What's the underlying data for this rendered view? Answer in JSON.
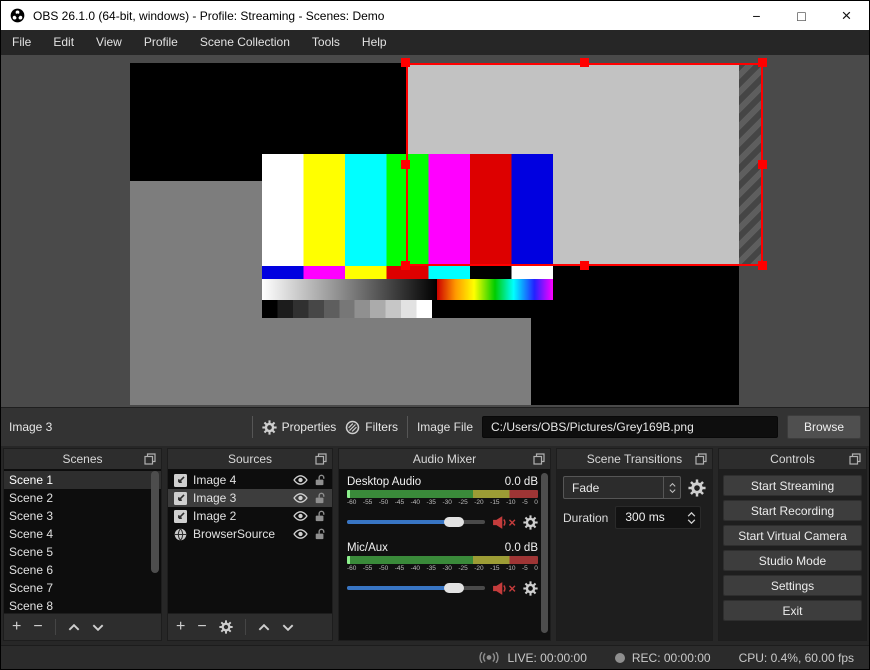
{
  "window": {
    "title": "OBS 26.1.0 (64-bit, windows) - Profile: Streaming - Scenes: Demo",
    "controls": {
      "minimize": "−",
      "maximize": "□",
      "close": "×"
    }
  },
  "menu": {
    "items": [
      "File",
      "Edit",
      "View",
      "Profile",
      "Scene Collection",
      "Tools",
      "Help"
    ]
  },
  "preview": {
    "selection_color": "#ff0000",
    "background": "#4a4a4a",
    "regions": {
      "black": "#000000",
      "grey": "#7d7d7d",
      "light_grey": "#c2c2c2"
    },
    "color_bars": [
      "#ffffff",
      "#ffff00",
      "#00ffff",
      "#00ff00",
      "#ff00ff",
      "#dd0000",
      "#0000e0"
    ],
    "strip_colors": [
      "#0000e0",
      "#ff00ff",
      "#ffff00",
      "#dd0000",
      "#00ffff",
      "#000000",
      "#ffffff"
    ]
  },
  "source_toolbar": {
    "source_name": "Image 3",
    "properties_label": "Properties",
    "filters_label": "Filters",
    "image_file_label": "Image File",
    "image_file_value": "C:/Users/OBS/Pictures/Grey169B.png",
    "browse_label": "Browse"
  },
  "docks": {
    "scenes": {
      "title": "Scenes",
      "items": [
        "Scene 1",
        "Scene 2",
        "Scene 3",
        "Scene 4",
        "Scene 5",
        "Scene 6",
        "Scene 7",
        "Scene 8"
      ],
      "selected": "Scene 1"
    },
    "sources": {
      "title": "Sources",
      "items": [
        {
          "label": "Image 4",
          "icon": "image-source-icon"
        },
        {
          "label": "Image 3",
          "icon": "image-source-icon"
        },
        {
          "label": "Image 2",
          "icon": "image-source-icon"
        },
        {
          "label": "BrowserSource",
          "icon": "globe-icon"
        }
      ],
      "selected": "Image 3"
    },
    "audio_mixer": {
      "title": "Audio Mixer",
      "ticks": [
        "-60",
        "-55",
        "-50",
        "-45",
        "-40",
        "-35",
        "-30",
        "-25",
        "-20",
        "-15",
        "-10",
        "-5",
        "0"
      ],
      "channels": [
        {
          "name": "Desktop Audio",
          "level": "0.0 dB"
        },
        {
          "name": "Mic/Aux",
          "level": "0.0 dB"
        }
      ],
      "slider_color": "#3875c4",
      "muted_color": "#c43c3c"
    },
    "scene_transitions": {
      "title": "Scene Transitions",
      "transition": "Fade",
      "duration_label": "Duration",
      "duration_value": "300 ms"
    },
    "controls": {
      "title": "Controls",
      "buttons": [
        "Start Streaming",
        "Start Recording",
        "Start Virtual Camera",
        "Studio Mode",
        "Settings",
        "Exit"
      ]
    }
  },
  "dock_toolbar_glyphs": {
    "add": "+",
    "remove": "−"
  },
  "status_bar": {
    "live": "LIVE: 00:00:00",
    "rec": "REC: 00:00:00",
    "cpu": "CPU: 0.4%, 60.00 fps"
  }
}
